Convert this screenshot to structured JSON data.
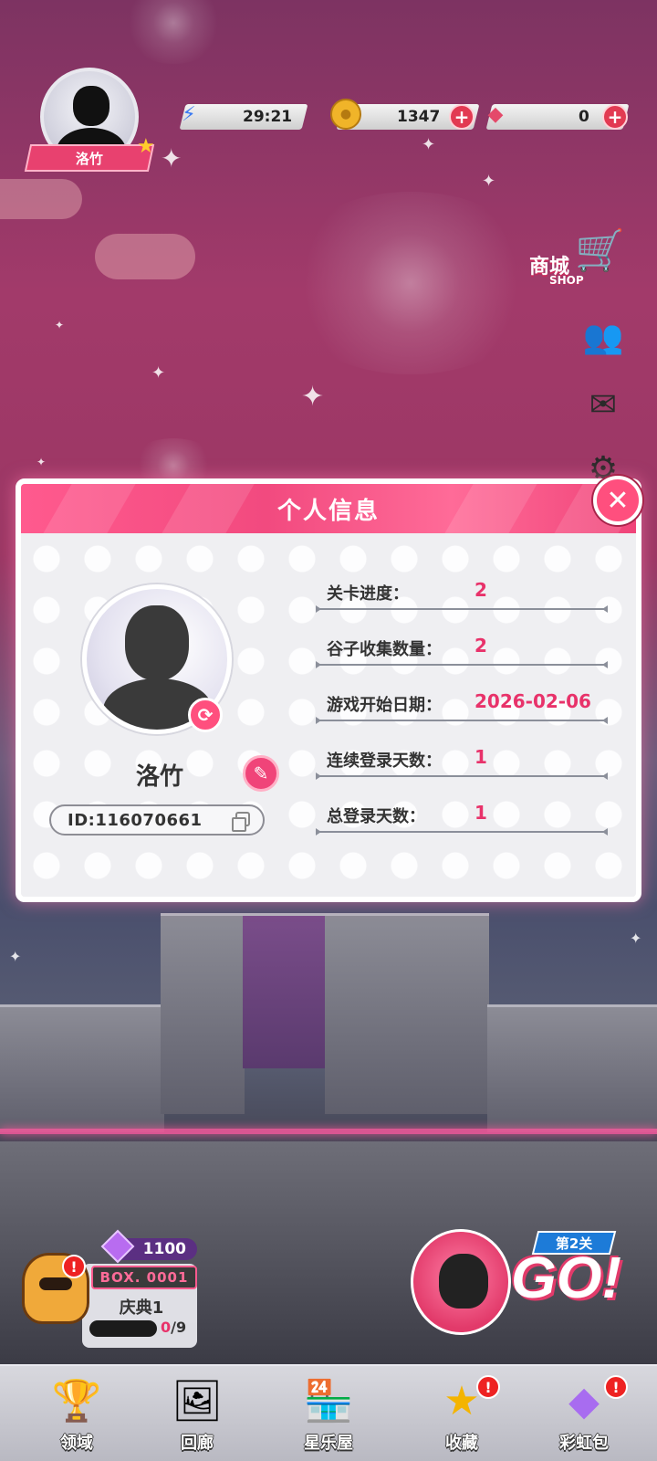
{
  "topbar": {
    "player_name": "洛竹",
    "energy_time": "29:21",
    "coins": "1347",
    "diamonds": "0"
  },
  "shop": {
    "label_cn": "商城",
    "label_en": "SHOP"
  },
  "profile_modal": {
    "title": "个人信息",
    "player_name": "洛竹",
    "player_id": "ID:116070661",
    "stats": [
      {
        "label": "关卡进度：",
        "value": "2"
      },
      {
        "label": "谷子收集数量：",
        "value": "2"
      },
      {
        "label": "游戏开始日期：",
        "value": "2026-02-06"
      },
      {
        "label": "连续登录天数：",
        "value": "1"
      },
      {
        "label": "总登录天数：",
        "value": "1"
      }
    ]
  },
  "box_panel": {
    "gems": "1100",
    "box_label": "BOX. 0001",
    "name": "庆典1",
    "progress_current": "0",
    "progress_total": "/9",
    "progress_fraction": 0
  },
  "go_panel": {
    "stage": "第2关",
    "go": "GO!"
  },
  "tabs": [
    {
      "label": "领域",
      "icon": "domain-icon"
    },
    {
      "label": "回廊",
      "icon": "corridor-icon"
    },
    {
      "label": "星乐屋",
      "icon": "star-house-icon"
    },
    {
      "label": "收藏",
      "icon": "collection-star-icon"
    },
    {
      "label": "彩虹包",
      "icon": "rainbow-pack-icon"
    }
  ],
  "colors": {
    "accent_pink": "#f04479",
    "value_pink": "#e8326a",
    "badge_red": "#e22222"
  }
}
